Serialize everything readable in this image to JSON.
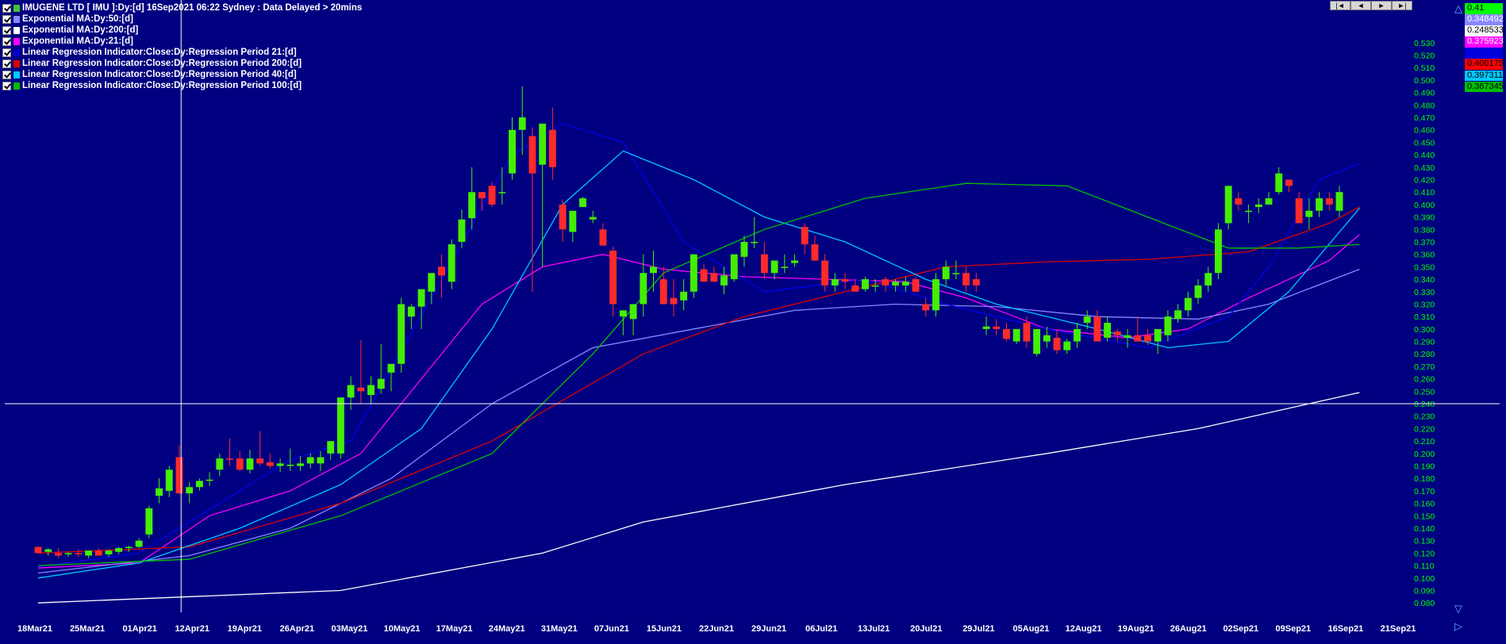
{
  "legend": [
    {
      "label": "IMUGENE LTD [ IMU ]:Dy:[d]  16Sep2021 06:22 Sydney : Data Delayed > 20mins",
      "color": "#3cc43c"
    },
    {
      "label": "Exponential MA:Dy:50:[d]",
      "color": "#8888ff"
    },
    {
      "label": "Exponential MA:Dy:200:[d]",
      "color": "#ffffff"
    },
    {
      "label": "Exponential MA:Dy:21:[d]",
      "color": "#ff00ff"
    },
    {
      "label": "Linear Regression Indicator:Close:Dy:Regression Period 21:[d]",
      "color": "#0000cc"
    },
    {
      "label": "Linear Regression Indicator:Close:Dy:Regression Period 200:[d]",
      "color": "#dd0000"
    },
    {
      "label": "Linear Regression Indicator:Close:Dy:Regression Period 40:[d]",
      "color": "#00c8ff"
    },
    {
      "label": "Linear Regression Indicator:Close:Dy:Regression Period 100:[d]",
      "color": "#00c000"
    }
  ],
  "nav_buttons": [
    "|◄",
    "◄",
    "►",
    "►|"
  ],
  "value_boxes": [
    {
      "text": "0.41",
      "bg": "#00ff00",
      "fg": "#000000"
    },
    {
      "text": "0.348492",
      "bg": "#8888ff",
      "fg": "#ffffff"
    },
    {
      "text": "0.248533",
      "bg": "#ffffff",
      "fg": "#000000"
    },
    {
      "text": "0.375923",
      "bg": "#ff00ff",
      "fg": "#ffffff"
    },
    {
      "text": "",
      "bg": "#0000dd",
      "fg": "#ffffff"
    },
    {
      "text": "0.400175",
      "bg": "#ff0000",
      "fg": "#000000"
    },
    {
      "text": "0.397311",
      "bg": "#00c8ff",
      "fg": "#000000"
    },
    {
      "text": "0.367345",
      "bg": "#00c000",
      "fg": "#000000"
    }
  ],
  "colors": {
    "background": "#000080",
    "bull": "#44ee00",
    "bear": "#ff2a2a",
    "ylabel": "#00ff00",
    "xlabel": "#ffffff",
    "crosshair": "#ffffff"
  },
  "crosshair": {
    "date": "12Apr21",
    "price": 0.24
  },
  "chart_data": {
    "type": "candlestick",
    "ylim": [
      0.075,
      0.535
    ],
    "y_ticks": [
      0.08,
      0.09,
      0.1,
      0.11,
      0.12,
      0.13,
      0.14,
      0.15,
      0.16,
      0.17,
      0.18,
      0.19,
      0.2,
      0.21,
      0.22,
      0.23,
      0.24,
      0.25,
      0.26,
      0.27,
      0.28,
      0.29,
      0.3,
      0.31,
      0.32,
      0.33,
      0.34,
      0.35,
      0.36,
      0.37,
      0.38,
      0.39,
      0.4,
      0.41,
      0.42,
      0.43,
      0.44,
      0.45,
      0.46,
      0.47,
      0.48,
      0.49,
      0.5,
      0.51,
      0.52,
      0.53
    ],
    "x_ticks": [
      "18Mar21",
      "25Mar21",
      "01Apr21",
      "12Apr21",
      "19Apr21",
      "26Apr21",
      "03May21",
      "10May21",
      "17May21",
      "24May21",
      "31May21",
      "07Jun21",
      "15Jun21",
      "22Jun21",
      "29Jun21",
      "06Jul21",
      "13Jul21",
      "20Jul21",
      "29Jul21",
      "05Aug21",
      "12Aug21",
      "19Aug21",
      "26Aug21",
      "02Sep21",
      "09Sep21",
      "16Sep21",
      "21Sep21"
    ],
    "ohlc": [
      [
        0.125,
        0.125,
        0.12,
        0.12
      ],
      [
        0.121,
        0.124,
        0.118,
        0.123
      ],
      [
        0.12,
        0.124,
        0.116,
        0.118
      ],
      [
        0.119,
        0.121,
        0.117,
        0.12
      ],
      [
        0.12,
        0.123,
        0.117,
        0.119
      ],
      [
        0.118,
        0.122,
        0.116,
        0.122
      ],
      [
        0.122,
        0.124,
        0.118,
        0.118
      ],
      [
        0.119,
        0.123,
        0.117,
        0.122
      ],
      [
        0.121,
        0.125,
        0.119,
        0.124
      ],
      [
        0.124,
        0.126,
        0.121,
        0.125
      ],
      [
        0.125,
        0.132,
        0.124,
        0.13
      ],
      [
        0.135,
        0.158,
        0.132,
        0.156
      ],
      [
        0.166,
        0.18,
        0.16,
        0.172
      ],
      [
        0.17,
        0.19,
        0.165,
        0.187
      ],
      [
        0.197,
        0.207,
        0.167,
        0.168
      ],
      [
        0.168,
        0.177,
        0.16,
        0.173
      ],
      [
        0.173,
        0.18,
        0.17,
        0.178
      ],
      [
        0.178,
        0.185,
        0.174,
        0.179
      ],
      [
        0.187,
        0.2,
        0.182,
        0.196
      ],
      [
        0.196,
        0.212,
        0.19,
        0.195
      ],
      [
        0.196,
        0.202,
        0.186,
        0.187
      ],
      [
        0.187,
        0.203,
        0.184,
        0.196
      ],
      [
        0.196,
        0.218,
        0.19,
        0.192
      ],
      [
        0.193,
        0.2,
        0.188,
        0.19
      ],
      [
        0.19,
        0.196,
        0.185,
        0.192
      ],
      [
        0.19,
        0.204,
        0.186,
        0.191
      ],
      [
        0.19,
        0.198,
        0.186,
        0.192
      ],
      [
        0.192,
        0.2,
        0.188,
        0.197
      ],
      [
        0.192,
        0.202,
        0.186,
        0.197
      ],
      [
        0.2,
        0.205,
        0.195,
        0.21
      ],
      [
        0.2,
        0.234,
        0.196,
        0.245
      ],
      [
        0.245,
        0.262,
        0.235,
        0.255
      ],
      [
        0.253,
        0.291,
        0.24,
        0.25
      ],
      [
        0.247,
        0.262,
        0.24,
        0.255
      ],
      [
        0.252,
        0.288,
        0.248,
        0.26
      ],
      [
        0.265,
        0.271,
        0.25,
        0.272
      ],
      [
        0.272,
        0.325,
        0.265,
        0.32
      ],
      [
        0.31,
        0.32,
        0.3,
        0.318
      ],
      [
        0.318,
        0.328,
        0.3,
        0.332
      ],
      [
        0.33,
        0.341,
        0.32,
        0.345
      ],
      [
        0.35,
        0.36,
        0.325,
        0.343
      ],
      [
        0.338,
        0.372,
        0.332,
        0.368
      ],
      [
        0.37,
        0.396,
        0.365,
        0.388
      ],
      [
        0.389,
        0.43,
        0.38,
        0.41
      ],
      [
        0.41,
        0.405,
        0.395,
        0.405
      ],
      [
        0.415,
        0.418,
        0.398,
        0.4
      ],
      [
        0.41,
        0.43,
        0.4,
        0.41
      ],
      [
        0.425,
        0.47,
        0.42,
        0.46
      ],
      [
        0.46,
        0.495,
        0.44,
        0.47
      ],
      [
        0.455,
        0.462,
        0.33,
        0.425
      ],
      [
        0.432,
        0.445,
        0.35,
        0.465
      ],
      [
        0.46,
        0.478,
        0.42,
        0.43
      ],
      [
        0.4,
        0.404,
        0.37,
        0.38
      ],
      [
        0.378,
        0.39,
        0.37,
        0.395
      ],
      [
        0.398,
        0.406,
        0.398,
        0.405
      ],
      [
        0.388,
        0.395,
        0.385,
        0.39
      ],
      [
        0.38,
        0.385,
        0.37,
        0.367
      ],
      [
        0.363,
        0.366,
        0.31,
        0.32
      ],
      [
        0.31,
        0.315,
        0.295,
        0.315
      ],
      [
        0.308,
        0.32,
        0.295,
        0.32
      ],
      [
        0.32,
        0.36,
        0.31,
        0.345
      ],
      [
        0.345,
        0.363,
        0.33,
        0.35
      ],
      [
        0.34,
        0.35,
        0.32,
        0.32
      ],
      [
        0.325,
        0.34,
        0.31,
        0.32
      ],
      [
        0.323,
        0.34,
        0.315,
        0.33
      ],
      [
        0.33,
        0.36,
        0.325,
        0.36
      ],
      [
        0.348,
        0.352,
        0.34,
        0.338
      ],
      [
        0.345,
        0.35,
        0.338,
        0.338
      ],
      [
        0.335,
        0.35,
        0.328,
        0.343
      ],
      [
        0.34,
        0.36,
        0.338,
        0.36
      ],
      [
        0.358,
        0.375,
        0.35,
        0.37
      ],
      [
        0.37,
        0.39,
        0.365,
        0.37
      ],
      [
        0.36,
        0.37,
        0.34,
        0.345
      ],
      [
        0.345,
        0.353,
        0.34,
        0.355
      ],
      [
        0.35,
        0.36,
        0.345,
        0.35
      ],
      [
        0.353,
        0.36,
        0.35,
        0.355
      ],
      [
        0.382,
        0.385,
        0.36,
        0.368
      ],
      [
        0.368,
        0.375,
        0.36,
        0.355
      ],
      [
        0.355,
        0.36,
        0.33,
        0.335
      ],
      [
        0.335,
        0.345,
        0.33,
        0.34
      ],
      [
        0.34,
        0.345,
        0.332,
        0.338
      ],
      [
        0.335,
        0.34,
        0.33,
        0.33
      ],
      [
        0.332,
        0.342,
        0.33,
        0.34
      ],
      [
        0.335,
        0.34,
        0.33,
        0.335
      ],
      [
        0.34,
        0.342,
        0.33,
        0.335
      ],
      [
        0.335,
        0.34,
        0.33,
        0.338
      ],
      [
        0.335,
        0.342,
        0.33,
        0.338
      ],
      [
        0.34,
        0.342,
        0.33,
        0.33
      ],
      [
        0.32,
        0.325,
        0.31,
        0.315
      ],
      [
        0.315,
        0.345,
        0.31,
        0.34
      ],
      [
        0.34,
        0.355,
        0.335,
        0.35
      ],
      [
        0.345,
        0.355,
        0.34,
        0.345
      ],
      [
        0.345,
        0.35,
        0.33,
        0.335
      ],
      [
        0.34,
        0.345,
        0.33,
        0.335
      ],
      [
        0.3,
        0.31,
        0.295,
        0.302
      ],
      [
        0.302,
        0.308,
        0.295,
        0.3
      ],
      [
        0.3,
        0.305,
        0.29,
        0.292
      ],
      [
        0.29,
        0.3,
        0.288,
        0.3
      ],
      [
        0.305,
        0.31,
        0.285,
        0.29
      ],
      [
        0.28,
        0.285,
        0.278,
        0.3
      ],
      [
        0.29,
        0.302,
        0.285,
        0.295
      ],
      [
        0.293,
        0.3,
        0.28,
        0.283
      ],
      [
        0.283,
        0.292,
        0.28,
        0.29
      ],
      [
        0.29,
        0.305,
        0.285,
        0.3
      ],
      [
        0.305,
        0.315,
        0.3,
        0.31
      ],
      [
        0.31,
        0.315,
        0.29,
        0.29
      ],
      [
        0.293,
        0.31,
        0.29,
        0.305
      ],
      [
        0.298,
        0.3,
        0.29,
        0.295
      ],
      [
        0.293,
        0.3,
        0.285,
        0.295
      ],
      [
        0.295,
        0.31,
        0.29,
        0.29
      ],
      [
        0.295,
        0.3,
        0.287,
        0.29
      ],
      [
        0.29,
        0.297,
        0.28,
        0.3
      ],
      [
        0.295,
        0.315,
        0.29,
        0.31
      ],
      [
        0.308,
        0.32,
        0.305,
        0.315
      ],
      [
        0.315,
        0.33,
        0.31,
        0.325
      ],
      [
        0.325,
        0.34,
        0.32,
        0.335
      ],
      [
        0.335,
        0.35,
        0.33,
        0.345
      ],
      [
        0.345,
        0.385,
        0.34,
        0.38
      ],
      [
        0.385,
        0.415,
        0.38,
        0.415
      ],
      [
        0.405,
        0.41,
        0.395,
        0.4
      ],
      [
        0.395,
        0.4,
        0.385,
        0.395
      ],
      [
        0.398,
        0.405,
        0.393,
        0.4
      ],
      [
        0.4,
        0.41,
        0.4,
        0.405
      ],
      [
        0.41,
        0.43,
        0.408,
        0.425
      ],
      [
        0.42,
        0.42,
        0.41,
        0.415
      ],
      [
        0.405,
        0.41,
        0.385,
        0.385
      ],
      [
        0.39,
        0.405,
        0.38,
        0.395
      ],
      [
        0.395,
        0.41,
        0.39,
        0.405
      ],
      [
        0.405,
        0.41,
        0.395,
        0.4
      ],
      [
        0.395,
        0.415,
        0.39,
        0.41
      ]
    ],
    "series": [
      {
        "color": "#ff00ff",
        "points": [
          [
            0,
            0.108
          ],
          [
            10,
            0.112
          ],
          [
            17,
            0.15
          ],
          [
            25,
            0.17
          ],
          [
            32,
            0.2
          ],
          [
            38,
            0.26
          ],
          [
            44,
            0.32
          ],
          [
            50,
            0.35
          ],
          [
            56,
            0.36
          ],
          [
            62,
            0.348
          ],
          [
            70,
            0.342
          ],
          [
            78,
            0.34
          ],
          [
            86,
            0.338
          ],
          [
            92,
            0.325
          ],
          [
            100,
            0.3
          ],
          [
            108,
            0.293
          ],
          [
            114,
            0.3
          ],
          [
            120,
            0.325
          ],
          [
            128,
            0.355
          ],
          [
            131,
            0.376
          ]
        ]
      },
      {
        "color": "#8888ff",
        "points": [
          [
            0,
            0.104
          ],
          [
            15,
            0.118
          ],
          [
            25,
            0.14
          ],
          [
            35,
            0.18
          ],
          [
            45,
            0.24
          ],
          [
            55,
            0.285
          ],
          [
            65,
            0.3
          ],
          [
            75,
            0.315
          ],
          [
            85,
            0.32
          ],
          [
            95,
            0.318
          ],
          [
            105,
            0.31
          ],
          [
            115,
            0.308
          ],
          [
            122,
            0.32
          ],
          [
            131,
            0.348
          ]
        ]
      },
      {
        "color": "#ffffff",
        "points": [
          [
            0,
            0.08
          ],
          [
            30,
            0.09
          ],
          [
            50,
            0.12
          ],
          [
            60,
            0.145
          ],
          [
            80,
            0.175
          ],
          [
            100,
            0.2
          ],
          [
            115,
            0.22
          ],
          [
            126,
            0.24
          ],
          [
            131,
            0.249
          ]
        ]
      },
      {
        "color": "#0000ee",
        "points": [
          [
            0,
            0.109
          ],
          [
            10,
            0.12
          ],
          [
            18,
            0.16
          ],
          [
            25,
            0.195
          ],
          [
            31,
            0.21
          ],
          [
            40,
            0.34
          ],
          [
            47,
            0.44
          ],
          [
            52,
            0.465
          ],
          [
            58,
            0.45
          ],
          [
            64,
            0.37
          ],
          [
            72,
            0.33
          ],
          [
            82,
            0.34
          ],
          [
            90,
            0.32
          ],
          [
            100,
            0.3
          ],
          [
            110,
            0.285
          ],
          [
            118,
            0.31
          ],
          [
            122,
            0.35
          ],
          [
            127,
            0.42
          ],
          [
            131,
            0.433
          ]
        ]
      },
      {
        "color": "#dd0000",
        "points": [
          [
            0,
            0.12
          ],
          [
            15,
            0.125
          ],
          [
            30,
            0.16
          ],
          [
            45,
            0.21
          ],
          [
            60,
            0.28
          ],
          [
            70,
            0.31
          ],
          [
            80,
            0.33
          ],
          [
            90,
            0.35
          ],
          [
            100,
            0.354
          ],
          [
            110,
            0.356
          ],
          [
            120,
            0.362
          ],
          [
            128,
            0.385
          ],
          [
            131,
            0.398
          ]
        ]
      },
      {
        "color": "#00c8ff",
        "points": [
          [
            0,
            0.1
          ],
          [
            10,
            0.112
          ],
          [
            20,
            0.14
          ],
          [
            30,
            0.175
          ],
          [
            38,
            0.22
          ],
          [
            45,
            0.3
          ],
          [
            52,
            0.4
          ],
          [
            58,
            0.443
          ],
          [
            65,
            0.42
          ],
          [
            72,
            0.39
          ],
          [
            80,
            0.37
          ],
          [
            88,
            0.34
          ],
          [
            95,
            0.32
          ],
          [
            105,
            0.3
          ],
          [
            112,
            0.285
          ],
          [
            118,
            0.29
          ],
          [
            124,
            0.33
          ],
          [
            131,
            0.397
          ]
        ]
      },
      {
        "color": "#00c000",
        "points": [
          [
            0,
            0.11
          ],
          [
            15,
            0.115
          ],
          [
            30,
            0.15
          ],
          [
            45,
            0.2
          ],
          [
            55,
            0.28
          ],
          [
            62,
            0.345
          ],
          [
            72,
            0.38
          ],
          [
            82,
            0.405
          ],
          [
            92,
            0.417
          ],
          [
            102,
            0.415
          ],
          [
            110,
            0.39
          ],
          [
            118,
            0.365
          ],
          [
            125,
            0.365
          ],
          [
            131,
            0.368
          ]
        ]
      }
    ]
  }
}
